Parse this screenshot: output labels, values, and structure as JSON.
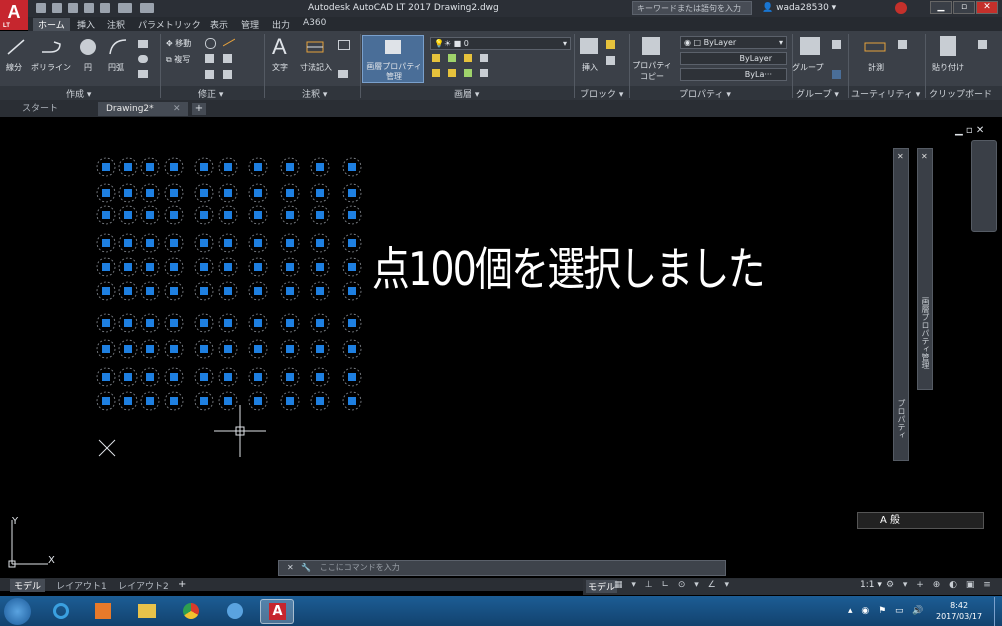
{
  "titlebar": {
    "app_title": "Autodesk AutoCAD LT 2017    Drawing2.dwg",
    "search_placeholder": "キーワードまたは語句を入力",
    "username": "wada28530"
  },
  "logo": {
    "letter": "A",
    "sub": "LT"
  },
  "menu_tabs": [
    "ホーム",
    "挿入",
    "注釈",
    "パラメトリック",
    "表示",
    "管理",
    "出力",
    "A360"
  ],
  "ribbon": {
    "draw": {
      "line": "線分",
      "polyline": "ポリライン",
      "circle": "円",
      "arc": "円弧"
    },
    "modify": {
      "move": "移動",
      "copy": "複写"
    },
    "annotation": {
      "text": "文字",
      "dimension": "寸法記入"
    },
    "layer_props_button": "画層プロパティ管理",
    "layer_current": "0",
    "block": {
      "insert": "挿入"
    },
    "properties": {
      "match": "プロパティコピー",
      "bylayer1": "ByLayer",
      "bylayer2": "ByLayer",
      "bylayer3": "ByLa···"
    },
    "groups": {
      "group": "グループ"
    },
    "utilities": {
      "measure": "計測"
    },
    "clipboard": {
      "paste": "貼り付け"
    },
    "panel_labels": [
      "作成 ▾",
      "修正 ▾",
      "注釈 ▾",
      "画層 ▾",
      "ブロック ▾",
      "プロパティ ▾",
      "グループ ▾",
      "ユーティリティ ▾",
      "クリップボード"
    ]
  },
  "doc_tabs": {
    "start": "スタート",
    "current": "Drawing2*"
  },
  "canvas": {
    "selection_message": "点100個を選択しました",
    "point_count": 100,
    "grip_color": "#1e7fe0",
    "palette_properties": "プロパティ",
    "palette_layers": "画層プロパティ管理",
    "ucs_x": "X",
    "ucs_y": "Y"
  },
  "command_placeholder": "ここにコマンドを入力",
  "layout_tabs": [
    "モデル",
    "レイアウト1",
    "レイアウト2"
  ],
  "status": {
    "model": "モデル",
    "scale": "1:1 ▾"
  },
  "ime": {
    "label": "A 般"
  },
  "clock": {
    "time": "8:42",
    "date": "2017/03/17"
  }
}
